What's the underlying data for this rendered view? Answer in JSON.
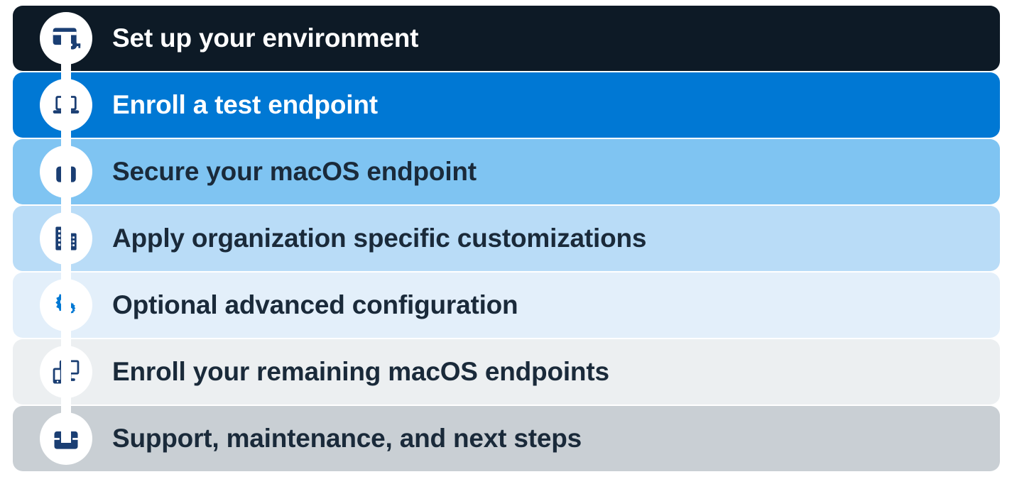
{
  "steps": [
    {
      "label": "Set up your environment",
      "bg": "#0d1a26",
      "text": "light",
      "icon": "card-key-icon",
      "icon_fill": "#1a3e73"
    },
    {
      "label": "Enroll a test endpoint",
      "bg": "#0078d4",
      "text": "light",
      "icon": "laptop-icon",
      "icon_fill": "#1a3e73"
    },
    {
      "label": "Secure your macOS endpoint",
      "bg": "#7fc4f2",
      "text": "dark",
      "icon": "lock-bag-icon",
      "icon_fill": "#1a3e73"
    },
    {
      "label": "Apply organization specific customizations",
      "bg": "#b9dcf7",
      "text": "dark",
      "icon": "building-icon",
      "icon_fill": "#1a3e73"
    },
    {
      "label": "Optional advanced configuration",
      "bg": "#e3effa",
      "text": "dark",
      "icon": "gears-icon",
      "icon_fill": "#0078d4"
    },
    {
      "label": "Enroll your remaining macOS endpoints",
      "bg": "#eceff1",
      "text": "dark",
      "icon": "devices-icon",
      "icon_fill": "#1a3e73"
    },
    {
      "label": "Support, maintenance, and next steps",
      "bg": "#c9cfd4",
      "text": "dark",
      "icon": "briefcase-icon",
      "icon_fill": "#1a3e73"
    }
  ]
}
